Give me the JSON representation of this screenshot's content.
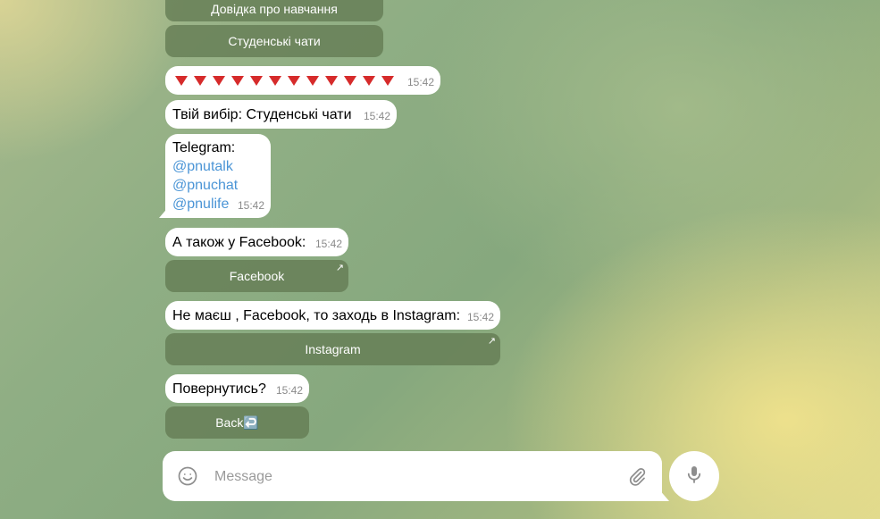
{
  "messages": {
    "arrows": {
      "glyph_count": 12,
      "color": "#d62b2b",
      "time": "15:42"
    },
    "choice": {
      "text": "Твій вибір: Студенські чати",
      "time": "15:42"
    },
    "telegram": {
      "title": "Telegram:",
      "links": [
        "@pnutalk",
        "@pnuchat",
        "@pnulife"
      ],
      "time": "15:42"
    },
    "facebook_msg": {
      "text": "А також у Facebook:",
      "time": "15:42"
    },
    "instagram_msg": {
      "text": "Не маєш , Facebook, то заходь в Instagram:",
      "time": "15:42"
    },
    "back_msg": {
      "text": "Повернутись?",
      "time": "15:42"
    }
  },
  "keyboard": {
    "top_buttons": [
      "Довідка про навчання",
      "Студенські чати"
    ],
    "facebook_button": "Facebook",
    "instagram_button": "Instagram",
    "back_button": "Back↩️"
  },
  "composer": {
    "placeholder": "Message",
    "icons": {
      "emoji": "smile-icon",
      "attach": "paperclip-icon",
      "mic": "microphone-icon"
    }
  },
  "colors": {
    "link": "#4b95d6",
    "button_bg": "#647c54",
    "bubble_bg": "#ffffff"
  }
}
